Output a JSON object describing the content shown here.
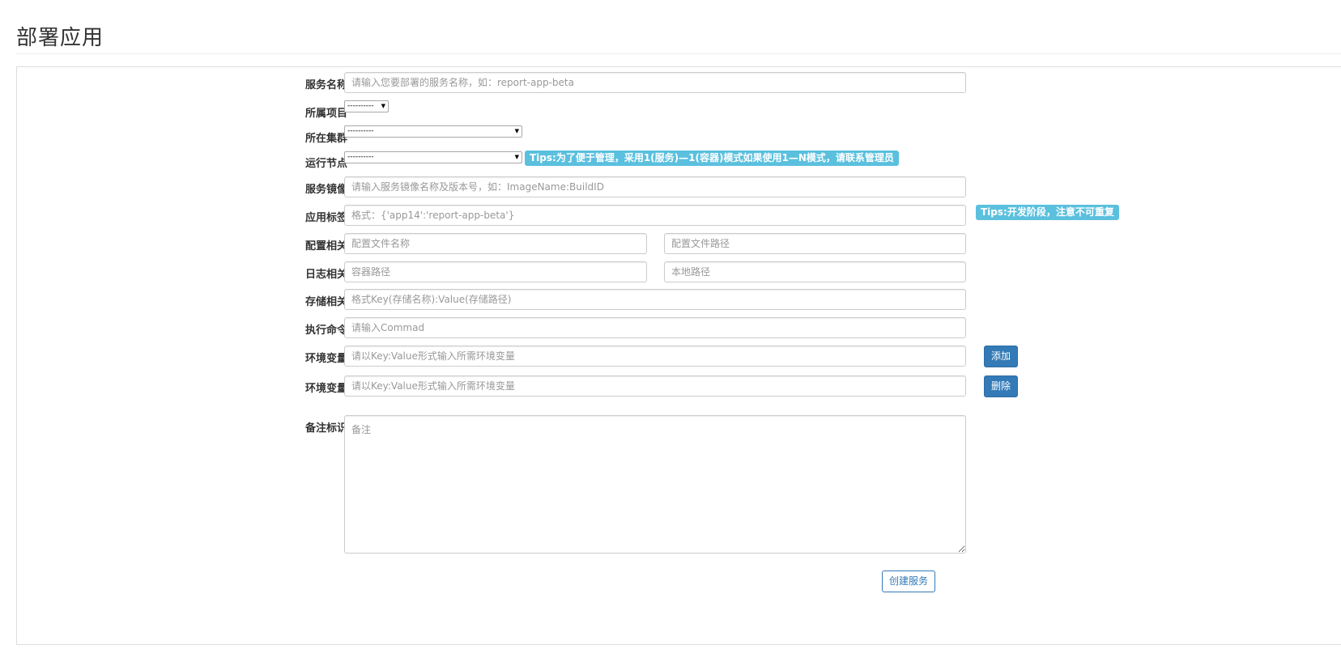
{
  "page": {
    "title": "部署应用"
  },
  "form": {
    "service_name": {
      "label": "服务名称",
      "placeholder": "请输入您要部署的服务名称，如：report-app-beta",
      "value": ""
    },
    "project": {
      "label": "所属项目",
      "selected": "----------"
    },
    "cluster": {
      "label": "所在集群",
      "selected": "----------"
    },
    "node": {
      "label": "运行节点",
      "selected": "----------",
      "tip": "Tips:为了便于管理，采用1(服务)—1(容器)模式如果使用1—N模式，请联系管理员"
    },
    "image": {
      "label": "服务镜像",
      "placeholder": "请输入服务镜像名称及版本号，如：ImageName:BuildID",
      "value": ""
    },
    "app_label": {
      "label": "应用标签",
      "placeholder": "格式：{'app14':'report-app-beta'}",
      "value": "",
      "tip": "Tips:开发阶段，注意不可重复"
    },
    "config": {
      "label": "配置相关",
      "name_placeholder": "配置文件名称",
      "path_placeholder": "配置文件路径"
    },
    "log": {
      "label": "日志相关",
      "container_placeholder": "容器路径",
      "local_placeholder": "本地路径"
    },
    "storage": {
      "label": "存储相关",
      "placeholder": "格式Key(存储名称):Value(存储路径)"
    },
    "command": {
      "label": "执行命令",
      "placeholder": "请输入Commad"
    },
    "env": [
      {
        "label": "环境变量",
        "placeholder": "请以Key:Value形式输入所需环境变量",
        "button": "添加"
      },
      {
        "label": "环境变量",
        "placeholder": "请以Key:Value形式输入所需环境变量",
        "button": "删除"
      }
    ],
    "remark": {
      "label": "备注标识",
      "placeholder": "备注"
    },
    "submit_label": "创建服务"
  },
  "colors": {
    "primary": "#337ab7",
    "tip": "#5bc0de",
    "border": "#cccccc",
    "panel_border": "#dddddd"
  }
}
